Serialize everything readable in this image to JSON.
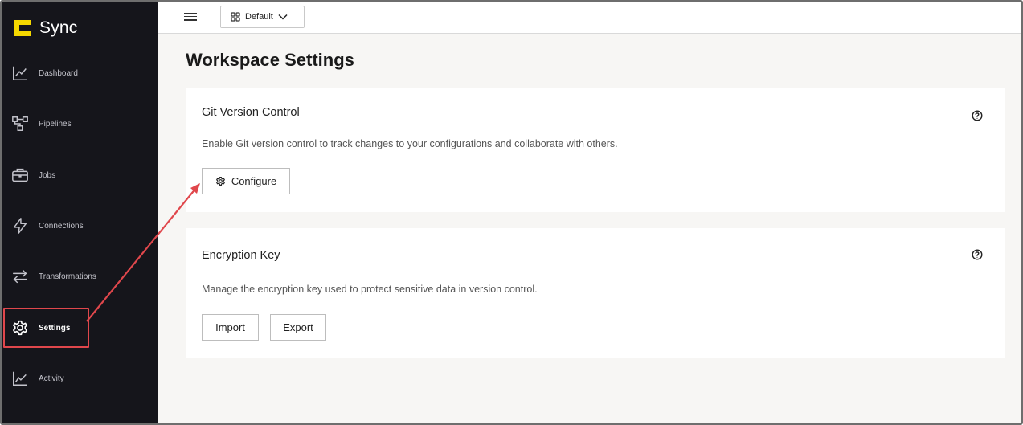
{
  "brand": {
    "name": "Sync",
    "accent": "#f5d800"
  },
  "sidebar": {
    "items": [
      {
        "label": "Dashboard",
        "icon": "chart-line-icon"
      },
      {
        "label": "Pipelines",
        "icon": "pipeline-icon"
      },
      {
        "label": "Jobs",
        "icon": "briefcase-icon"
      },
      {
        "label": "Connections",
        "icon": "lightning-icon"
      },
      {
        "label": "Transformations",
        "icon": "swap-arrows-icon"
      },
      {
        "label": "Settings",
        "icon": "gear-icon",
        "active": true
      },
      {
        "label": "Activity",
        "icon": "activity-chart-icon"
      }
    ]
  },
  "topbar": {
    "workspace_select": "Default"
  },
  "page": {
    "title": "Workspace Settings"
  },
  "git_card": {
    "title": "Git Version Control",
    "description": "Enable Git version control to track changes to your configurations and collaborate with others.",
    "configure_label": "Configure"
  },
  "encryption_card": {
    "title": "Encryption Key",
    "description": "Manage the encryption key used to protect sensitive data in version control.",
    "import_label": "Import",
    "export_label": "Export"
  },
  "annotation": {
    "color": "#e0474c"
  }
}
